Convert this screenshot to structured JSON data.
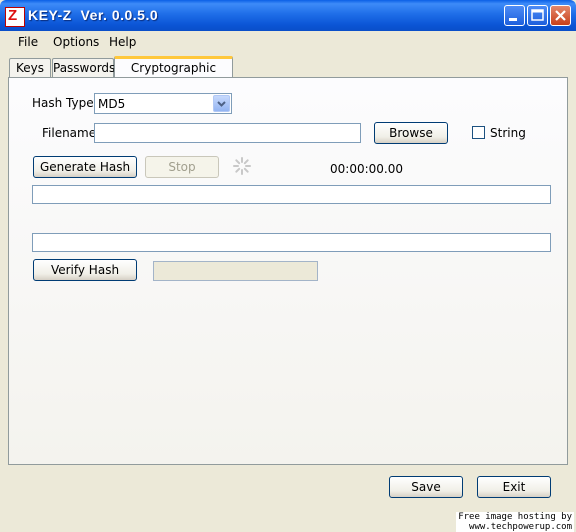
{
  "window": {
    "title": "KEY-Z  Ver. 0.0.5.0"
  },
  "menu": {
    "items": [
      "File",
      "Options",
      "Help"
    ]
  },
  "tabs": [
    "Keys",
    "Passwords",
    "Cryptographic Hashes"
  ],
  "hash_tab": {
    "hash_type_label": "Hash Type",
    "hash_type_value": "MD5",
    "filename_label": "Filename",
    "filename_value": "",
    "browse_label": "Browse",
    "string_label": "String",
    "generate_label": "Generate Hash",
    "stop_label": "Stop",
    "elapsed_time": "00:00:00.00",
    "hash_output_value": "",
    "verify_input_value": "",
    "verify_label": "Verify Hash",
    "verify_result_value": ""
  },
  "footer": {
    "save_label": "Save",
    "exit_label": "Exit"
  },
  "watermark": {
    "line1": "Free image hosting by",
    "line2": "www.techpowerup.com"
  },
  "colors": {
    "titlebar": "#0A55D6",
    "tab_highlight": "#FFC83C",
    "close_button": "#C8401A"
  },
  "icons": {
    "app": "z-logo-icon",
    "spinner": "busy-spinner-icon"
  }
}
